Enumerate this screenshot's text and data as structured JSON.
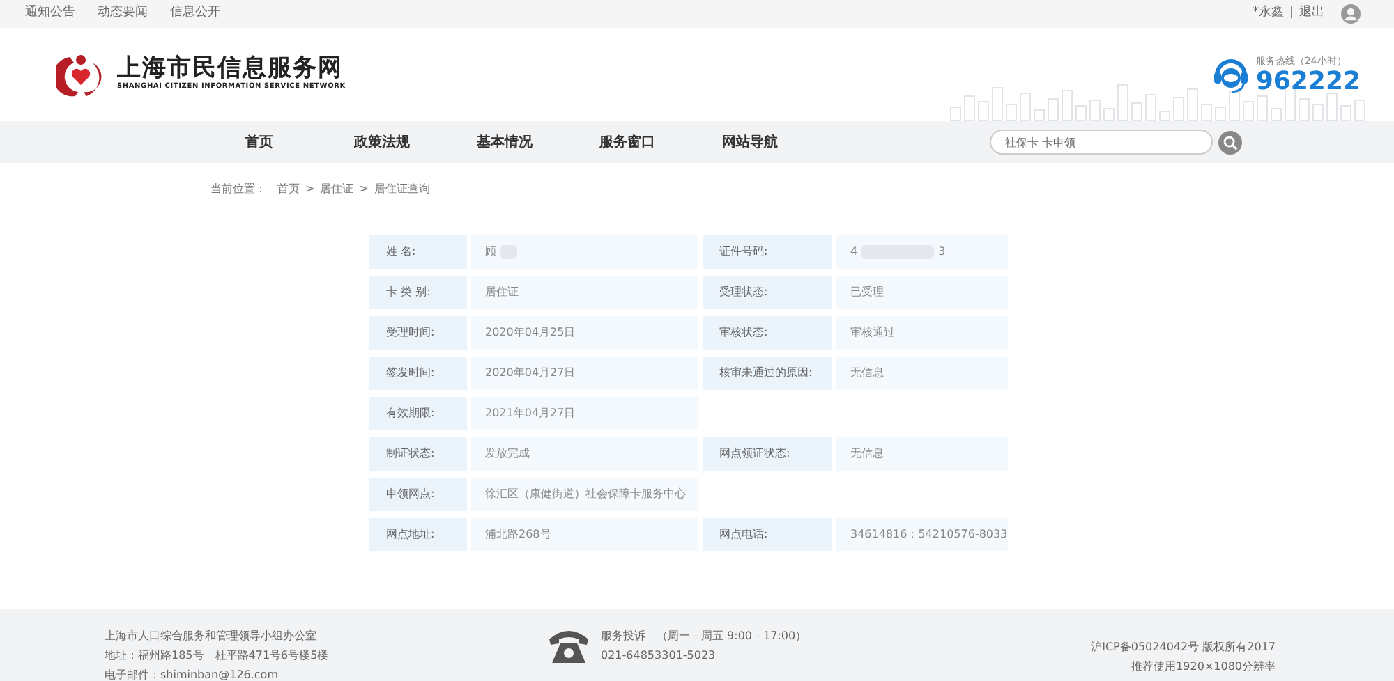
{
  "top_bar": {
    "links": [
      "通知公告",
      "动态要闻",
      "信息公开"
    ],
    "user": "*永鑫",
    "separator": "|",
    "logout": "退出"
  },
  "header": {
    "logo_title": "上海市民信息服务网",
    "logo_subtitle": "SHANGHAI CITIZEN INFORMATION SERVICE NETWORK",
    "hotline_label": "服务热线（24小时）",
    "hotline_number": "962222"
  },
  "nav": {
    "items": [
      "首页",
      "政策法规",
      "基本情况",
      "服务窗口",
      "网站导航"
    ],
    "search": {
      "value": "社保卡 卡申领"
    }
  },
  "breadcrumb": {
    "label": "当前位置：",
    "items": [
      "首页",
      "居住证",
      "居住证查询"
    ],
    "separator": ">"
  },
  "table": {
    "rows": [
      {
        "cells": [
          {
            "label": "姓 名:",
            "value": "顾",
            "redacted": true
          },
          {
            "label": "证件号码:",
            "value": "4",
            "redacted": true,
            "value_end": "3"
          }
        ]
      },
      {
        "cells": [
          {
            "label": "卡 类 别:",
            "value": "居住证"
          },
          {
            "label": "受理状态:",
            "value": "已受理"
          }
        ]
      },
      {
        "cells": [
          {
            "label": "受理时间:",
            "value": "2020年04月25日"
          },
          {
            "label": "审核状态:",
            "value": "审核通过"
          }
        ]
      },
      {
        "cells": [
          {
            "label": "签发时间:",
            "value": "2020年04月27日"
          },
          {
            "label": "核审未通过的原因:",
            "value": "无信息"
          }
        ]
      },
      {
        "cells": [
          {
            "label": "有效期限:",
            "value": "2021年04月27日"
          }
        ]
      },
      {
        "cells": [
          {
            "label": "制证状态:",
            "value": "发放完成"
          },
          {
            "label": "网点领证状态:",
            "value": "无信息"
          }
        ]
      },
      {
        "cells": [
          {
            "label": "申领网点:",
            "value": "徐汇区（康健街道）社会保障卡服务中心"
          }
        ]
      },
      {
        "cells": [
          {
            "label": "网点地址:",
            "value": "浦北路268号"
          },
          {
            "label": "网点电话:",
            "value": "34614816；54210576-8033"
          }
        ]
      }
    ]
  },
  "footer": {
    "office": [
      "上海市人口综合服务和管理领导小组办公室",
      "地址：福州路185号　桂平路471号6号楼5楼",
      "电子邮件：shiminban@126.com"
    ],
    "complaint": [
      "服务投诉　（周一－周五 9:00－17:00）",
      "021-64853301-5023"
    ],
    "legal": [
      "沪ICP备05024042号 版权所有2017",
      "推荐使用1920×1080分辨率"
    ]
  }
}
